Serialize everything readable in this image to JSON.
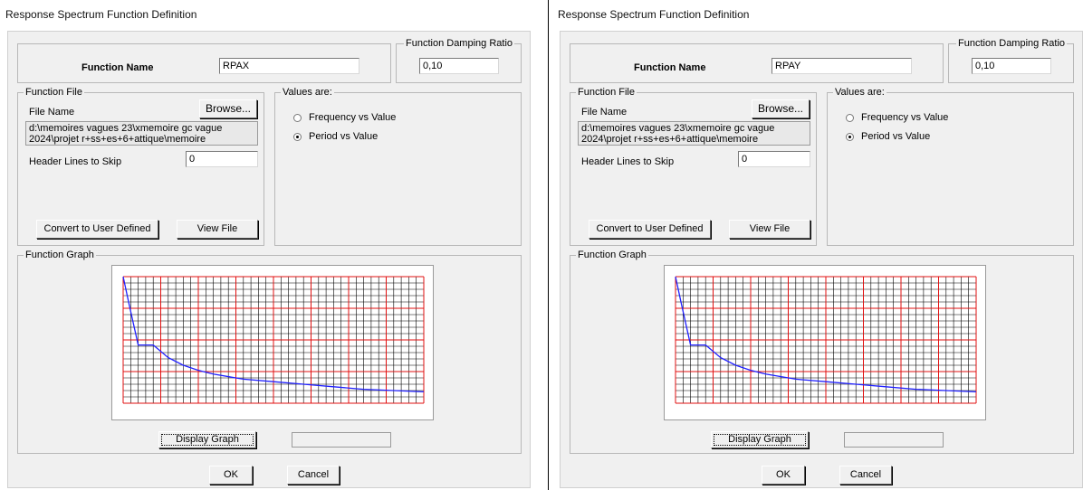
{
  "panes": [
    {
      "title": "Response Spectrum  Function Definition",
      "function_name_label": "Function Name",
      "function_name_value": "RPAX",
      "damping_group_title": "Function Damping Ratio",
      "damping_value": "0,10",
      "file_group_title": "Function File",
      "file_name_label": "File Name",
      "browse_label": "Browse...",
      "file_path": "d:\\memoires vagues 23\\xmemoire gc vague 2024\\projet r+ss+es+6+attique\\memoire",
      "header_lines_label": "Header Lines to Skip",
      "header_lines_value": "0",
      "convert_label": "Convert to User Defined",
      "view_file_label": "View File",
      "values_group_title": "Values are:",
      "option_frequency": "Frequency vs Value",
      "option_period": "Period vs Value",
      "selected_option": "period",
      "graph_group_title": "Function Graph",
      "display_graph_label": "Display Graph",
      "ok_label": "OK",
      "cancel_label": "Cancel"
    },
    {
      "title": "Response Spectrum  Function Definition",
      "function_name_label": "Function Name",
      "function_name_value": "RPAY",
      "damping_group_title": "Function Damping Ratio",
      "damping_value": "0,10",
      "file_group_title": "Function File",
      "file_name_label": "File Name",
      "browse_label": "Browse...",
      "file_path": "d:\\memoires vagues 23\\xmemoire gc vague 2024\\projet r+ss+es+6+attique\\memoire",
      "header_lines_label": "Header Lines to Skip",
      "header_lines_value": "0",
      "convert_label": "Convert to User Defined",
      "view_file_label": "View File",
      "values_group_title": "Values are:",
      "option_frequency": "Frequency vs Value",
      "option_period": "Period vs Value",
      "selected_option": "period",
      "graph_group_title": "Function Graph",
      "display_graph_label": "Display Graph",
      "ok_label": "OK",
      "cancel_label": "Cancel"
    }
  ],
  "colors": {
    "grid_minor": "#000000",
    "grid_major": "#e01010",
    "curve": "#2020ff"
  },
  "chart_data": {
    "type": "line",
    "title": "",
    "xlabel": "",
    "ylabel": "",
    "grid": true,
    "x": [
      0,
      0.02,
      0.05,
      0.08,
      0.1,
      0.15,
      0.2,
      0.25,
      0.3,
      0.4,
      0.5,
      0.6,
      0.7,
      0.8,
      0.9,
      1.0
    ],
    "series": [
      {
        "values": [
          1.0,
          0.78,
          0.46,
          0.46,
          0.46,
          0.36,
          0.3,
          0.26,
          0.23,
          0.19,
          0.17,
          0.15,
          0.13,
          0.11,
          0.1,
          0.09
        ]
      }
    ]
  }
}
